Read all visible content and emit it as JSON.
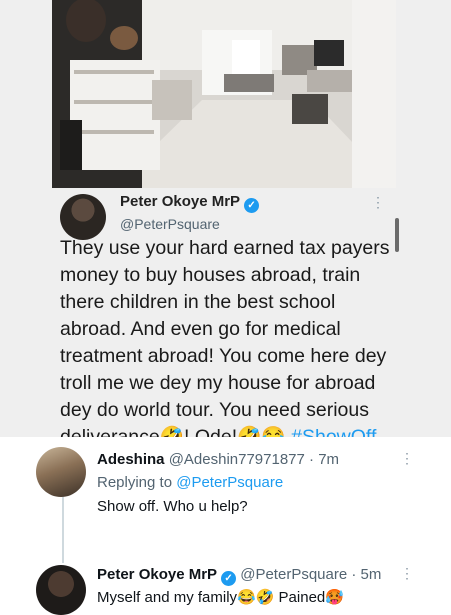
{
  "embed": {
    "author_name": "Peter Okoye MrP",
    "author_handle": "@PeterPsquare",
    "body_lines": [
      "They use your hard earned tax payers",
      "money to buy houses abroad, train",
      "there children in the best school",
      "abroad. And even go for medical",
      "treatment abroad! You come here dey",
      "troll me we dey my house for abroad",
      "dey do world tour. You need serious"
    ],
    "last_line": {
      "before": "deliverance",
      "emoji1": "🤣",
      "mid": "! Ode!",
      "emoji2": "🤣😂",
      "hashtag": "#ShowOff"
    },
    "more_icon": "⋮"
  },
  "reply": {
    "name": "Adeshina",
    "handle_time": "@Adeshin77971877 · 7m",
    "replying_prefix": "Replying to ",
    "replying_to": "@PeterPsquare",
    "text": "Show off. Who u help?",
    "more_icon": "⋮"
  },
  "response": {
    "name": "Peter Okoye MrP",
    "handle_time": "@PeterPsquare · 5m",
    "text": "Myself and my family😂🤣 Pained🥵",
    "more_icon": "⋮"
  },
  "colors": {
    "link": "#1d9bf0",
    "muted": "#536471",
    "verified": "#1d9bf0"
  }
}
